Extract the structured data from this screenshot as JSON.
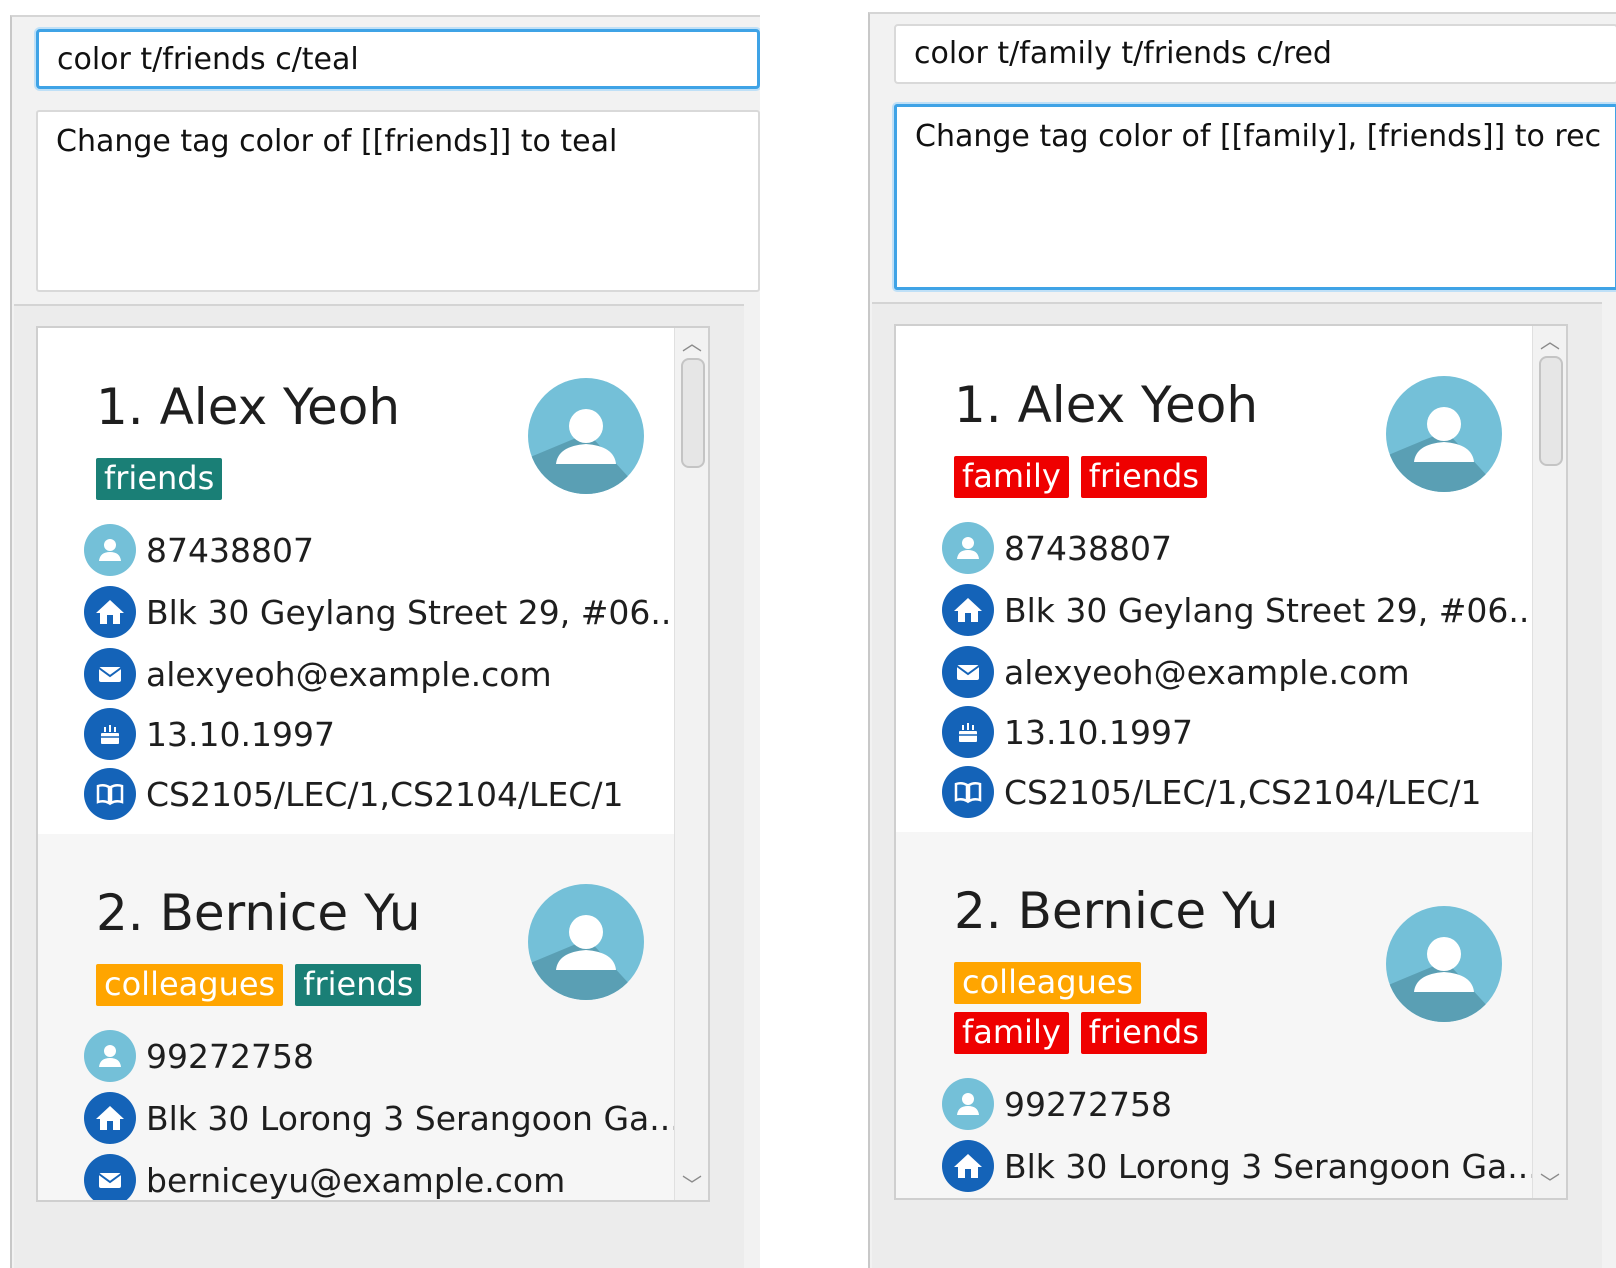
{
  "panels": [
    {
      "command_input": "color t/friends c/teal",
      "result_text": "Change tag color of [[friends]] to teal",
      "persons": [
        {
          "name": "1. Alex Yeoh",
          "tags": [
            {
              "label": "friends",
              "color": "#1a7f76"
            }
          ],
          "phone": "87438807",
          "address": "Blk 30 Geylang Street 29, #06...",
          "email": "alexyeoh@example.com",
          "birthday": "13.10.1997",
          "modules": "CS2105/LEC/1,CS2104/LEC/1"
        },
        {
          "name": "2. Bernice Yu",
          "tags": [
            {
              "label": "colleagues",
              "color": "#ffa500"
            },
            {
              "label": "friends",
              "color": "#1a7f76"
            }
          ],
          "phone": "99272758",
          "address": "Blk 30 Lorong 3 Serangoon Ga...",
          "email": "berniceyu@example.com"
        }
      ]
    },
    {
      "command_input": "color t/family t/friends c/red",
      "result_text": "Change tag color of [[family], [friends]] to rec",
      "persons": [
        {
          "name": "1. Alex Yeoh",
          "tags": [
            {
              "label": "family",
              "color": "#ef0000"
            },
            {
              "label": "friends",
              "color": "#ef0000"
            }
          ],
          "phone": "87438807",
          "address": "Blk 30 Geylang Street 29, #06...",
          "email": "alexyeoh@example.com",
          "birthday": "13.10.1997",
          "modules": "CS2105/LEC/1,CS2104/LEC/1"
        },
        {
          "name": "2. Bernice Yu",
          "tags": [
            {
              "label": "colleagues",
              "color": "#ffa500"
            },
            {
              "label": "family",
              "color": "#ef0000"
            },
            {
              "label": "friends",
              "color": "#ef0000"
            }
          ],
          "phone": "99272758",
          "address": "Blk 30 Lorong 3 Serangoon Ga..."
        }
      ]
    }
  ],
  "icons": {
    "phone": "person-icon",
    "address": "home-icon",
    "email": "mail-icon",
    "birthday": "cake-icon",
    "modules": "book-icon",
    "avatar": "avatar-icon"
  }
}
